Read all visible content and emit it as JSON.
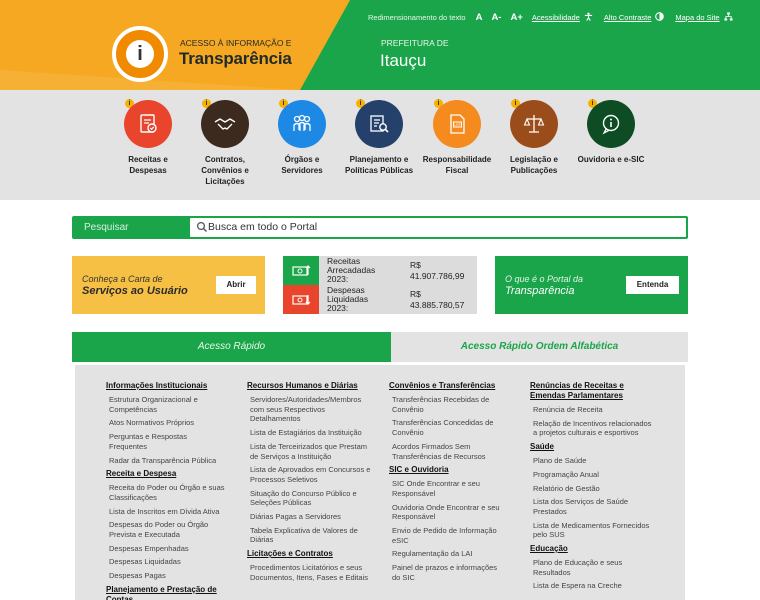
{
  "header": {
    "brand_small": "ACESSO À INFORMAÇÃO E",
    "brand_big": "Transparência",
    "prefeitura_small": "PREFEITURA DE",
    "prefeitura_big": "Itauçu",
    "topbar": {
      "resize_text": "Redimensionamento do texto",
      "font_a": "A",
      "font_minus": "A-",
      "font_plus": "A+",
      "accessibility": "Acessibilidade",
      "contrast": "Alto Contraste",
      "sitemap": "Mapa do Site"
    },
    "colors": {
      "orange": "#f7a823",
      "green": "#1ba54a"
    }
  },
  "iconbar": {
    "items": [
      {
        "label": "Receitas e Despesas",
        "icon": "receipt-icon",
        "color": "#e8452c"
      },
      {
        "label": "Contratos, Convênios e Licitações",
        "icon": "handshake-icon",
        "color": "#3d2a1e"
      },
      {
        "label": "Órgãos e Servidores",
        "icon": "people-icon",
        "color": "#1e88e5"
      },
      {
        "label": "Planejamento e Políticas Públicas",
        "icon": "document-search-icon",
        "color": "#25416b"
      },
      {
        "label": "Responsabilidade Fiscal",
        "icon": "law-document-icon",
        "color": "#f58a1f"
      },
      {
        "label": "Legislação e Publicações",
        "icon": "scales-icon",
        "color": "#9a4d1b"
      },
      {
        "label": "Ouvidoria e e-SIC",
        "icon": "info-speech-icon",
        "color": "#0e4d23"
      }
    ]
  },
  "search": {
    "label": "Pesquisar",
    "placeholder": "Busca em todo o Portal"
  },
  "carta": {
    "line1": "Conheça a Carta de",
    "line2": "Serviços ao Usuário",
    "button": "Abrir"
  },
  "stats": {
    "receitas": {
      "label_lines": [
        "Receitas",
        "Arrecadadas",
        "2023:"
      ],
      "currency": "R$",
      "value": "41.907.786,99",
      "color": "#1ba54a"
    },
    "despesas": {
      "label_lines": [
        "Despesas",
        "Liquidadas",
        "2023:"
      ],
      "currency": "R$",
      "value": "43.885.780,57",
      "color": "#e8452c"
    }
  },
  "portal": {
    "line1": "O que é o Portal da",
    "line2": "Transparência",
    "button": "Entenda"
  },
  "tabs": {
    "active": "Acesso Rápido",
    "inactive": "Acesso Rápido Ordem Alfabética"
  },
  "columns": [
    {
      "sections": [
        {
          "title": "Informações Institucionais",
          "links": [
            "Estrutura Organizacional e Competências",
            "Atos Normativos Próprios",
            "Perguntas e Respostas Frequentes",
            "Radar da Transparência Pública"
          ]
        },
        {
          "title": "Receita e Despesa",
          "links": [
            "Receita do Poder ou Órgão e suas Classificações",
            "Lista de Inscritos em Dívida Ativa",
            "Despesas do Poder ou Órgão Prevista e Executada",
            "Despesas Empenhadas",
            "Despesas Liquidadas",
            "Despesas Pagas"
          ]
        },
        {
          "title": "Planejamento e Prestação de Contas",
          "links": []
        }
      ]
    },
    {
      "sections": [
        {
          "title": "Recursos Humanos e Diárias",
          "links": [
            "Servidores/Autoridades/Membros com seus Respectivos Detalhamentos",
            "Lista de Estagiários da Instituição",
            "Lista de Terceirizados que Prestam de Serviços a Instituição",
            "Lista de Aprovados em Concursos e Processos Seletivos",
            "Situação do Concurso Público e Seleções Públicas",
            "Diárias Pagas a Servidores",
            "Tabela Explicativa de Valores de Diárias"
          ]
        },
        {
          "title": "Licitações e Contratos",
          "links": [
            "Procedimentos Licitatórios e seus Documentos, Itens, Fases e Editais"
          ]
        }
      ]
    },
    {
      "sections": [
        {
          "title": "Convênios e Transferências",
          "links": [
            "Transferências Recebidas de Convênio",
            "Transferências Concedidas de Convênio",
            "Acordos Firmados Sem Transferências de Recursos"
          ]
        },
        {
          "title": "SIC e Ouvidoria",
          "links": [
            "SIC Onde Encontrar e seu Responsável",
            "Ouvidoria Onde Encontrar e seu Responsável",
            "Envio de Pedido de Informação eSIC",
            "Regulamentação da LAI",
            "Painel de prazos e informações do SIC"
          ]
        }
      ]
    },
    {
      "sections": [
        {
          "title": "Renúncias de Receitas e Emendas Parlamentares",
          "links": [
            "Renúncia de Receita",
            "Relação de Incentivos relacionados a projetos culturais e esportivos"
          ]
        },
        {
          "title": "Saúde",
          "links": [
            "Plano de Saúde",
            "Programação Anual",
            "Relatório de Gestão",
            "Lista dos Serviços de Saúde Prestados",
            "Lista de Medicamentos Fornecidos pelo SUS"
          ]
        },
        {
          "title": "Educação",
          "links": [
            "Plano de Educação e seus Resultados",
            "Lista de Espera na Creche"
          ]
        }
      ]
    }
  ]
}
